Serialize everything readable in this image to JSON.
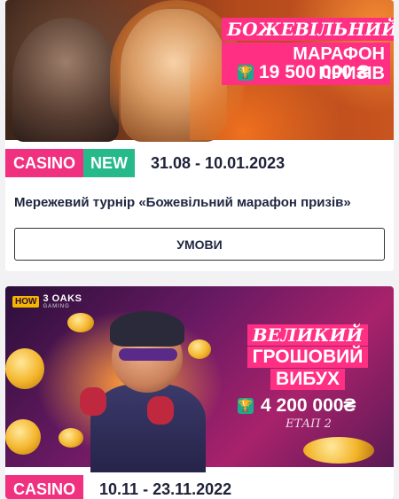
{
  "cards": [
    {
      "banner": {
        "title_line1": "БОЖЕВІЛЬНИЙ",
        "title_line2": "МАРАФОН ПРИЗІВ",
        "prize": "19 500 000 ₴"
      },
      "tags": {
        "category": "CASINO",
        "badge": "NEW"
      },
      "dates": "31.08 - 10.01.2023",
      "description": "Мережевий турнір «Божевільний марафон призів»",
      "button_label": "УМОВИ"
    },
    {
      "banner": {
        "logo_mark": "HOW",
        "logo_text": "3 OAKS",
        "logo_sub": "GAMING",
        "title_line1": "ВЕЛИКИЙ",
        "title_line2": "ГРОШОВИЙ",
        "title_line3": "ВИБУХ",
        "prize": "4 200 000₴",
        "stage": "ЕТАП 2"
      },
      "tags": {
        "category": "CASINO"
      },
      "dates": "10.11 - 23.11.2022"
    }
  ],
  "colors": {
    "accent_pink": "#f0317f",
    "accent_green": "#26b98a",
    "text_dark": "#1f2640",
    "page_bg": "#f2f2f4"
  },
  "icons": {
    "trophy": "trophy-icon"
  }
}
